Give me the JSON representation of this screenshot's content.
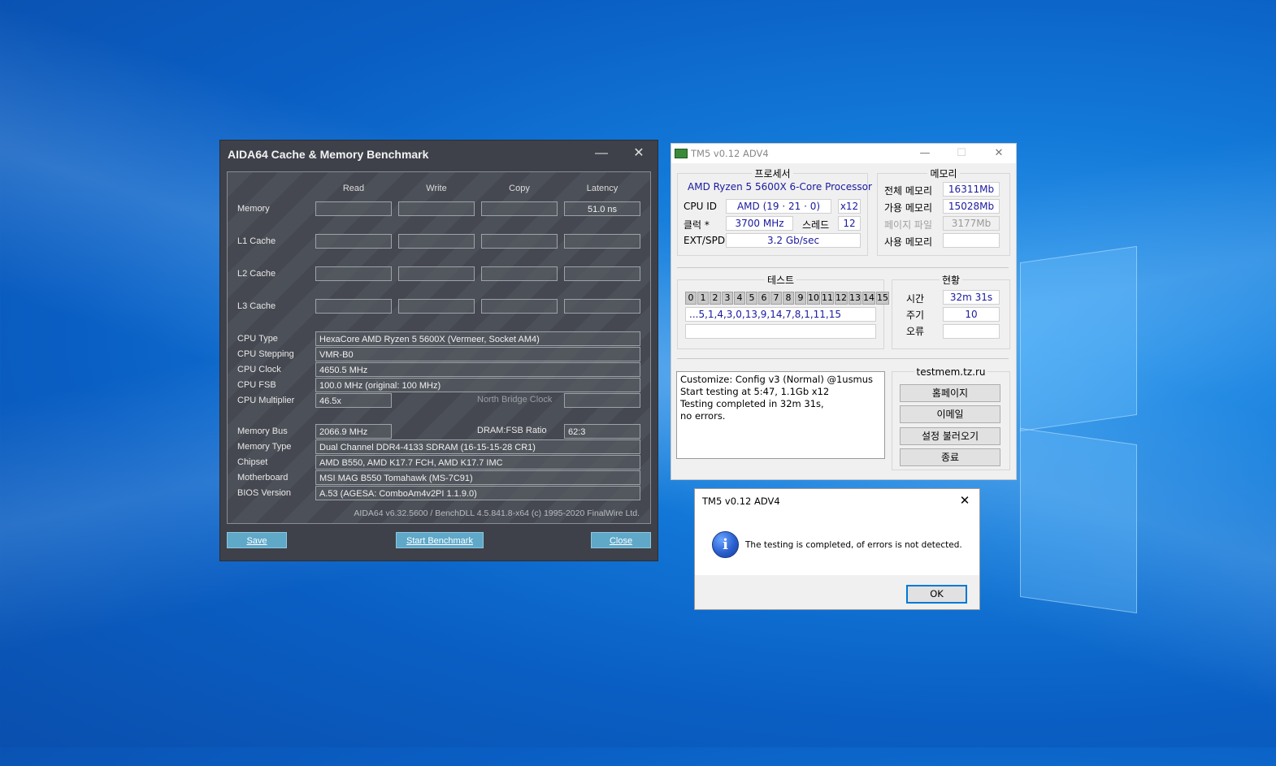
{
  "aida": {
    "title": "AIDA64 Cache & Memory Benchmark",
    "columns": [
      "Read",
      "Write",
      "Copy",
      "Latency"
    ],
    "rows": [
      "Memory",
      "L1 Cache",
      "L2 Cache",
      "L3 Cache"
    ],
    "memory_latency": "51.0 ns",
    "info": [
      {
        "label": "CPU Type",
        "value": "HexaCore AMD Ryzen 5 5600X  (Vermeer, Socket AM4)"
      },
      {
        "label": "CPU Stepping",
        "value": "VMR-B0"
      },
      {
        "label": "CPU Clock",
        "value": "4650.5 MHz"
      },
      {
        "label": "CPU FSB",
        "value": "100.0 MHz  (original: 100 MHz)"
      },
      {
        "label": "CPU Multiplier",
        "value": "46.5x"
      }
    ],
    "north_bridge_label": "North Bridge Clock",
    "memory_bus_label": "Memory Bus",
    "memory_bus_value": "2066.9 MHz",
    "dram_fsb_label": "DRAM:FSB Ratio",
    "dram_fsb_value": "62:3",
    "info2": [
      {
        "label": "Memory Type",
        "value": "Dual Channel DDR4-4133 SDRAM  (16-15-15-28 CR1)"
      },
      {
        "label": "Chipset",
        "value": "AMD B550, AMD K17.7 FCH, AMD K17.7 IMC"
      },
      {
        "label": "Motherboard",
        "value": "MSI MAG B550 Tomahawk (MS-7C91)"
      },
      {
        "label": "BIOS Version",
        "value": "A.53  (AGESA: ComboAm4v2PI 1.1.9.0)"
      }
    ],
    "footer": "AIDA64 v6.32.5600 / BenchDLL 4.5.841.8-x64  (c) 1995-2020 FinalWire Ltd.",
    "buttons": {
      "save": "Save",
      "start": "Start Benchmark",
      "close": "Close"
    },
    "minimize_glyph": "—",
    "close_glyph": "✕"
  },
  "tm5": {
    "title": "TM5 v0.12 ADV4",
    "processor_group": "프로세서",
    "cpu_name": "AMD Ryzen 5 5600X 6-Core Processor",
    "cpu_id_label": "CPU ID",
    "cpu_id_value": "AMD  (19 · 21 · 0)",
    "threads_x": "x12",
    "clock_label": "클럭 *",
    "clock_value": "3700 MHz",
    "thread_label": "스레드",
    "thread_value": "12",
    "extspd_label": "EXT/SPD",
    "extspd_value": "3.2 Gb/sec",
    "memory_group": "메모리",
    "mem_total_label": "전체 메모리",
    "mem_total_value": "16311Mb",
    "mem_avail_label": "가용 메모리",
    "mem_avail_value": "15028Mb",
    "pagefile_label": "페이지 파일",
    "pagefile_value": "3177Mb",
    "mem_used_label": "사용 메모리",
    "mem_used_value": "",
    "test_group": "테스트",
    "tests": [
      "0",
      "1",
      "2",
      "3",
      "4",
      "5",
      "6",
      "7",
      "8",
      "9",
      "10",
      "11",
      "12",
      "13",
      "14",
      "15"
    ],
    "test_sequence": "...5,1,4,3,0,13,9,14,7,8,1,11,15",
    "status_group": "현황",
    "time_label": "시간",
    "time_value": "32m 31s",
    "cycle_label": "주기",
    "cycle_value": "10",
    "error_label": "오류",
    "error_value": "",
    "log_lines": [
      "Customize: Config v3 (Normal) @1usmus",
      "Start testing at 5:47, 1.1Gb x12",
      "Testing completed in 32m 31s,",
      "no errors."
    ],
    "site_group": "testmem.tz.ru",
    "buttons": [
      "홈페이지",
      "이메일",
      "설정 불러오기",
      "종료"
    ],
    "minimize_glyph": "—",
    "maximize_glyph": "☐",
    "close_glyph": "✕"
  },
  "dialog": {
    "title": "TM5 v0.12 ADV4",
    "message": "The testing is completed, of errors is not detected.",
    "ok": "OK",
    "close_glyph": "✕",
    "info_glyph": "i"
  }
}
